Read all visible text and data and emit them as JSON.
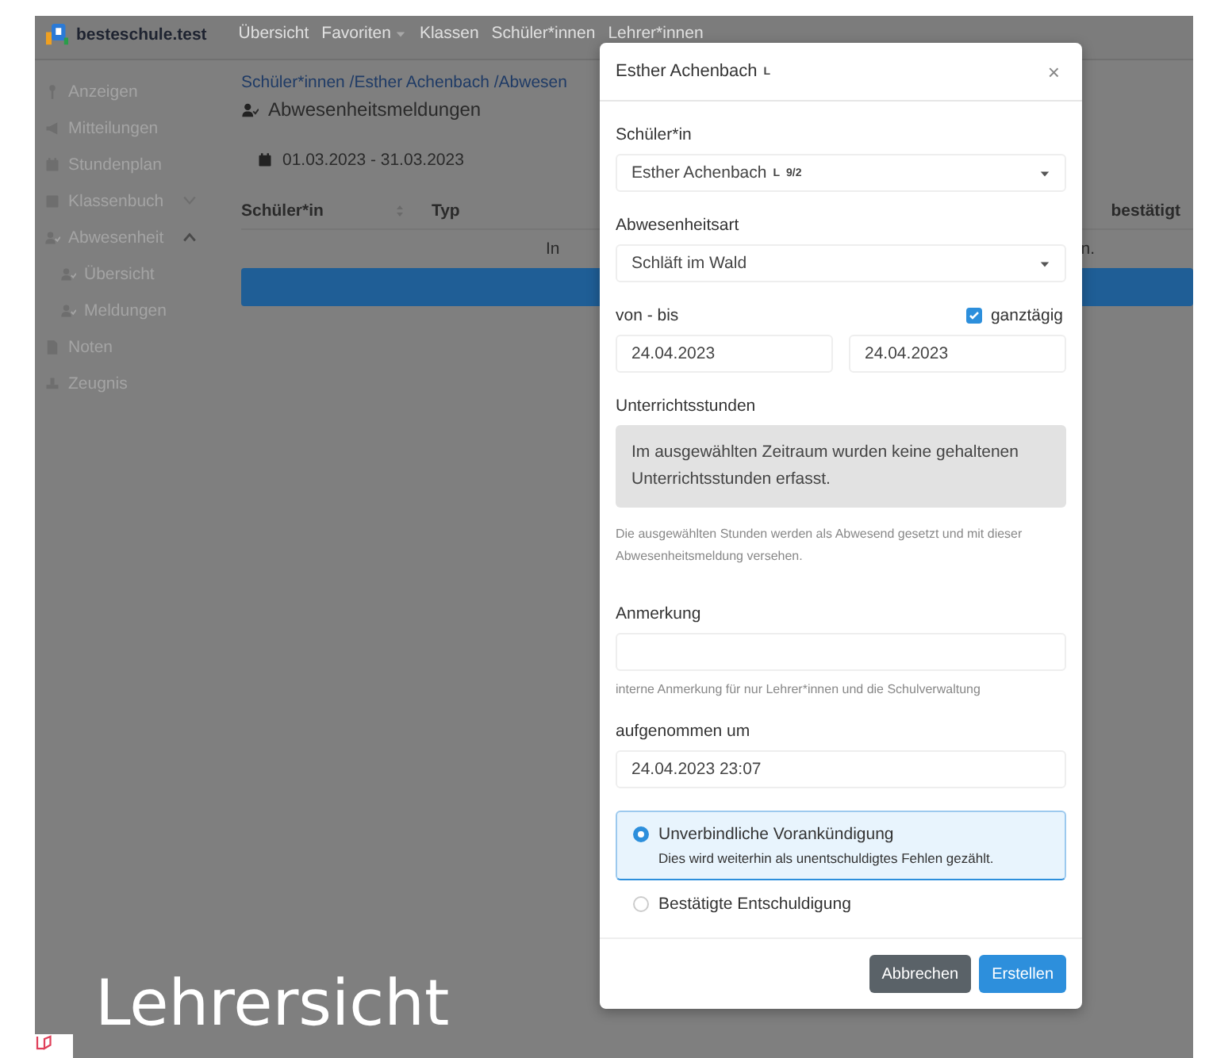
{
  "app": {
    "brand": "besteschule.test",
    "nav": [
      {
        "label": "Übersicht",
        "dropdown": false
      },
      {
        "label": "Favoriten",
        "dropdown": true
      },
      {
        "label": "Klassen",
        "dropdown": false
      },
      {
        "label": "Schüler*innen",
        "dropdown": false
      },
      {
        "label": "Lehrer*innen",
        "dropdown": false
      }
    ],
    "sidebar": [
      {
        "label": "Anzeigen"
      },
      {
        "label": "Mitteilungen"
      },
      {
        "label": "Stundenplan"
      },
      {
        "label": "Klassenbuch",
        "expanded": false
      },
      {
        "label": "Abwesenheit",
        "expanded": true,
        "children": [
          {
            "label": "Übersicht"
          },
          {
            "label": "Meldungen"
          }
        ]
      },
      {
        "label": "Noten"
      },
      {
        "label": "Zeugnis"
      }
    ]
  },
  "page": {
    "breadcrumb": "Schüler*innen /Esther Achenbach /Abwesen",
    "title": "Abwesenheitsmeldungen",
    "date_range": "01.03.2023 - 31.03.2023",
    "columns": [
      "Schüler*in",
      "Typ",
      "bestätigt"
    ],
    "message_start": "In",
    "message_end": "n."
  },
  "modal": {
    "title": "Esther Achenbach",
    "title_badge": "L",
    "close_label": "×",
    "student": {
      "label": "Schüler*in",
      "value": "Esther Achenbach",
      "badge": "L",
      "class": "9/2"
    },
    "absence_type": {
      "label": "Abwesenheitsart",
      "value": "Schläft im Wald"
    },
    "period": {
      "label": "von - bis",
      "all_day_label": "ganztägig",
      "all_day": true,
      "from": "24.04.2023",
      "to": "24.04.2023"
    },
    "lessons": {
      "label": "Unterrichtsstunden",
      "notice": "Im ausgewählten Zeitraum wurden keine gehaltenen Unterrichtsstunden erfasst.",
      "help": "Die ausgewählten Stunden werden als Abwesend gesetzt und mit dieser Abwesenheitsmeldung versehen."
    },
    "remark": {
      "label": "Anmerkung",
      "help": "interne Anmerkung für nur Lehrer*innen und die Schulverwaltung"
    },
    "recorded": {
      "label": "aufgenommen um",
      "value": "24.04.2023 23:07"
    },
    "options": [
      {
        "label": "Unverbindliche Vorankündigung",
        "description": "Dies wird weiterhin als unentschuldigtes Fehlen gezählt.",
        "selected": true
      },
      {
        "label": "Bestätigte Entschuldigung",
        "selected": false
      }
    ],
    "buttons": [
      {
        "label": "Abbrechen",
        "kind": "secondary"
      },
      {
        "label": "Erstellen",
        "kind": "primary"
      }
    ]
  },
  "caption": "Lehrersicht"
}
